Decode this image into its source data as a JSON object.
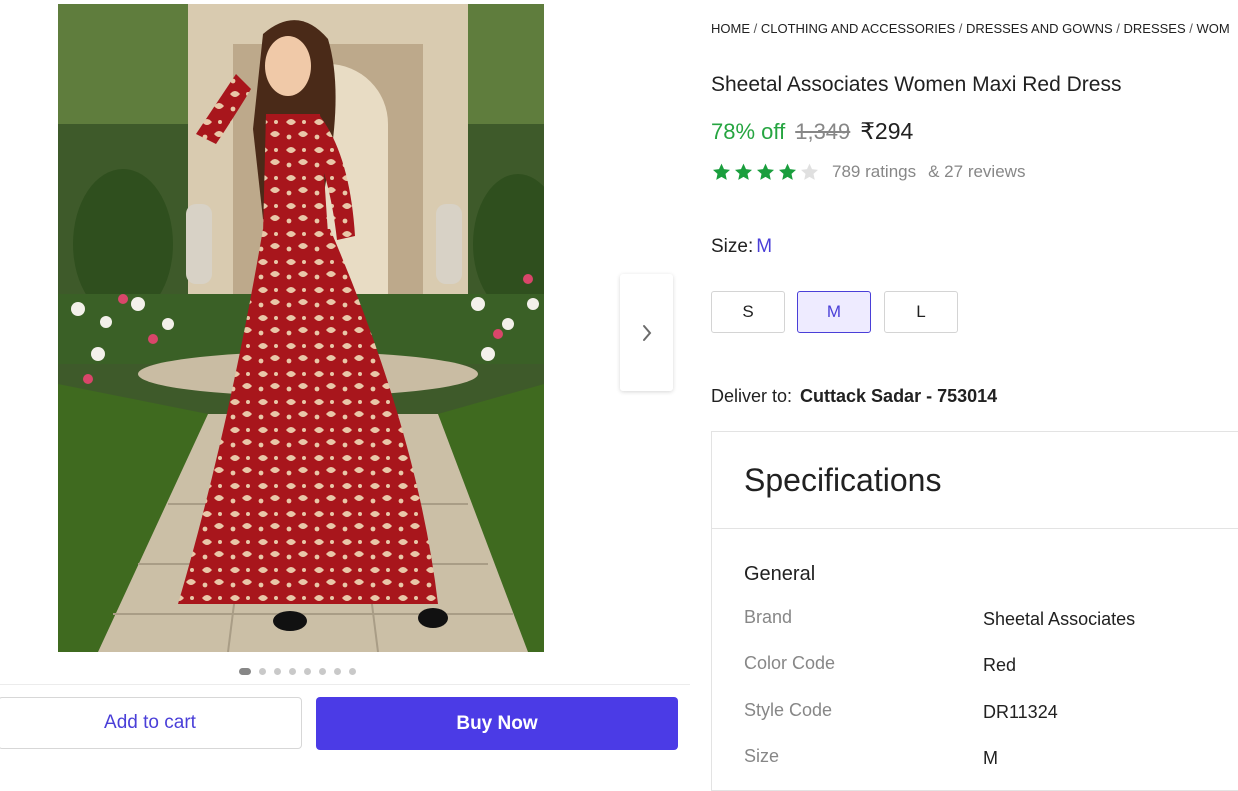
{
  "breadcrumb": [
    "HOME",
    "CLOTHING AND ACCESSORIES",
    "DRESSES AND GOWNS",
    "DRESSES",
    "WOM"
  ],
  "product": {
    "title": "Sheetal Associates Women Maxi Red Dress",
    "discount": "78% off",
    "mrp": "1,349",
    "price": "₹294",
    "rating_stars": 4,
    "ratings": "789 ratings",
    "reviews": "& 27 reviews"
  },
  "size": {
    "label": "Size:",
    "selected": "M",
    "options": [
      "S",
      "M",
      "L"
    ]
  },
  "delivery": {
    "label": "Deliver to:",
    "location": "Cuttack Sadar - 753014"
  },
  "specs": {
    "title": "Specifications",
    "group": "General",
    "rows": [
      {
        "key": "Brand",
        "value": "Sheetal Associates"
      },
      {
        "key": "Color Code",
        "value": "Red"
      },
      {
        "key": "Style Code",
        "value": "DR11324"
      },
      {
        "key": "Size",
        "value": "M"
      }
    ]
  },
  "actions": {
    "add_to_cart": "Add to cart",
    "buy_now": "Buy Now"
  },
  "carousel": {
    "total": 8,
    "active": 1
  },
  "colors": {
    "accent": "#4b3be6",
    "discount_green": "#26a541",
    "star_green": "#1a9e3d",
    "dress_red": "#a8161c"
  }
}
